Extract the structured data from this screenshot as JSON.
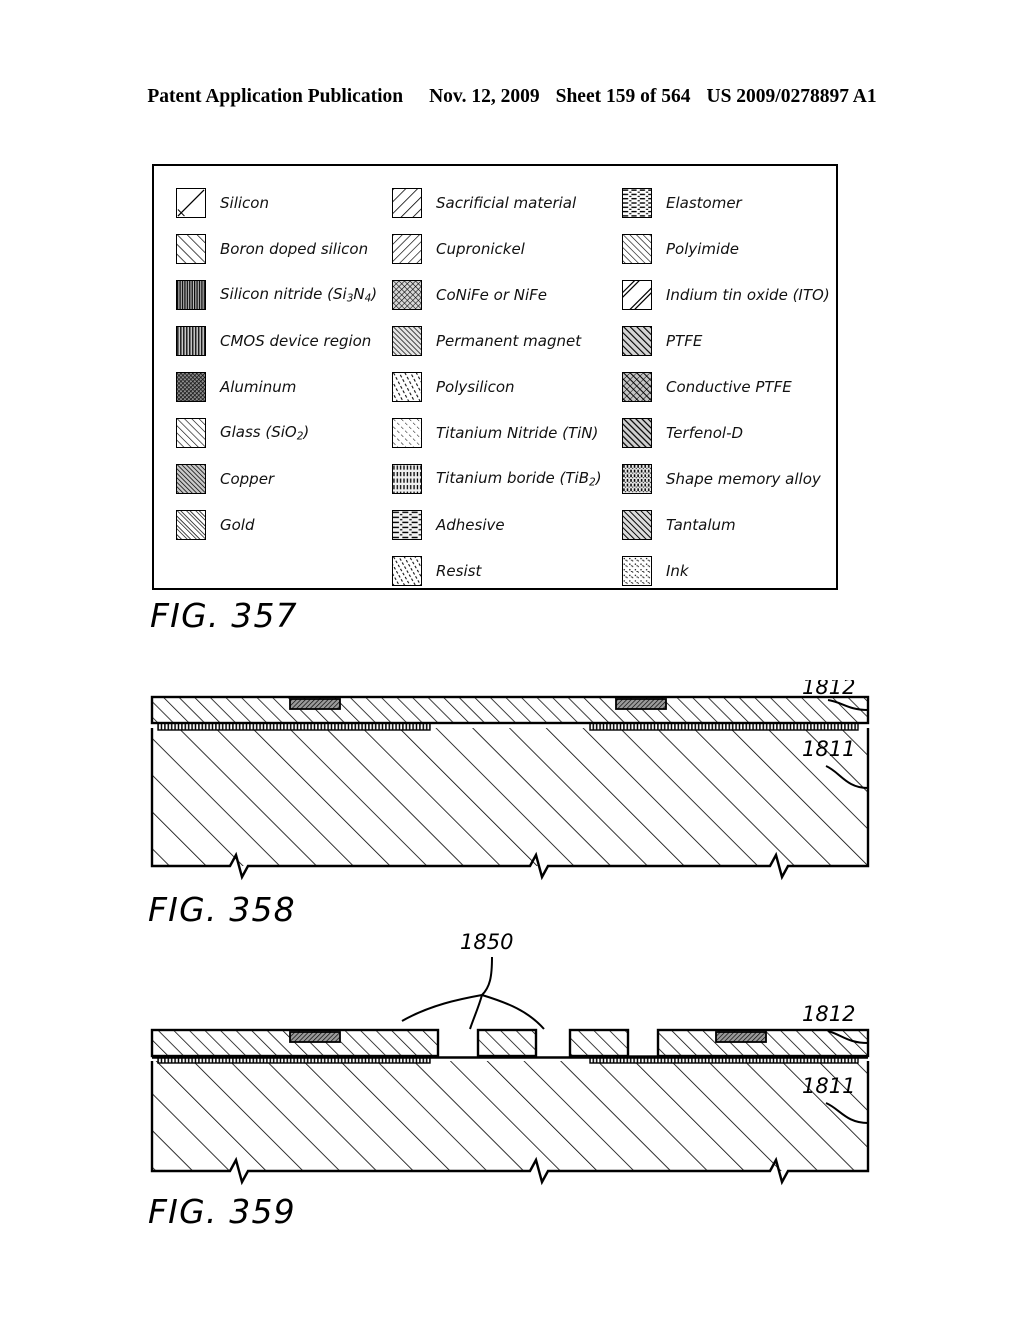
{
  "header": {
    "publication": "Patent Application Publication",
    "date": "Nov. 12, 2009",
    "sheet": "Sheet 159 of 564",
    "patent_number": "US 2009/0278897 A1"
  },
  "legend": {
    "figure_label": "FIG. 357",
    "columns": [
      {
        "items": [
          {
            "label": "Silicon",
            "pattern": "single-diagonal"
          },
          {
            "label": "Boron doped silicon",
            "pattern": "diagonal-hatch-wide"
          },
          {
            "label": "Silicon nitride (Si3N4)",
            "label_plain": "Silicon nitride (Si",
            "sub1": "3",
            "mid": "N",
            "sub2": "4",
            "tail": ")",
            "pattern": "vertical-dense"
          },
          {
            "label": "CMOS device region",
            "pattern": "vertical-medium"
          },
          {
            "label": "Aluminum",
            "pattern": "crosshatch-fine"
          },
          {
            "label": "Glass (SiO2)",
            "label_plain": "Glass (SiO",
            "sub1": "2",
            "tail": ")",
            "pattern": "diagonal-hatch-med"
          },
          {
            "label": "Copper",
            "pattern": "diagonal-dense-dark"
          },
          {
            "label": "Gold",
            "pattern": "diagonal-double"
          }
        ]
      },
      {
        "items": [
          {
            "label": "Sacrificial material",
            "pattern": "diagonal-wide-rev"
          },
          {
            "label": "Cupronickel",
            "pattern": "diagonal-rev-med"
          },
          {
            "label": "CoNiFe or NiFe",
            "pattern": "crosshatch-diagonal"
          },
          {
            "label": "Permanent magnet",
            "pattern": "diagonal-hatch-tight"
          },
          {
            "label": "Polysilicon",
            "pattern": "short-dashes-diag"
          },
          {
            "label": "Titanium Nitride (TiN)",
            "pattern": "diagonal-sparse"
          },
          {
            "label": "Titanium boride (TiB2)",
            "label_plain": "Titanium boride (TiB",
            "sub1": "2",
            "tail": ")",
            "pattern": "vertical-dashed"
          },
          {
            "label": "Adhesive",
            "pattern": "horizontal-dashed"
          },
          {
            "label": "Resist",
            "pattern": "tick-marks"
          }
        ]
      },
      {
        "items": [
          {
            "label": "Elastomer",
            "pattern": "horizontal-dashes"
          },
          {
            "label": "Polyimide",
            "pattern": "diagonal-med-rev"
          },
          {
            "label": "Indium tin oxide (ITO)",
            "pattern": "wide-diagonal-band"
          },
          {
            "label": "PTFE",
            "pattern": "diagonal-bold-dark"
          },
          {
            "label": "Conductive PTFE",
            "pattern": "diagonal-bold-cross"
          },
          {
            "label": "Terfenol-D",
            "pattern": "diagonal-thick-dark"
          },
          {
            "label": "Shape memory alloy",
            "pattern": "vertical-dotted"
          },
          {
            "label": "Tantalum",
            "pattern": "diagonal-dark-med"
          },
          {
            "label": "Ink",
            "pattern": "stipple-dots"
          }
        ]
      }
    ]
  },
  "figures": [
    {
      "caption": "FIG. 358",
      "reference_numerals": [
        {
          "value": "1812",
          "points_to": "upper-glass-layer"
        },
        {
          "value": "1811",
          "points_to": "silicon-substrate"
        }
      ]
    },
    {
      "caption": "FIG. 359",
      "reference_numerals": [
        {
          "value": "1850",
          "points_to": "etched-gaps"
        },
        {
          "value": "1812",
          "points_to": "upper-glass-layer"
        },
        {
          "value": "1811",
          "points_to": "silicon-substrate"
        }
      ]
    }
  ],
  "colors": {
    "ink": "#000000",
    "paper": "#ffffff",
    "hatch": "#111111"
  }
}
